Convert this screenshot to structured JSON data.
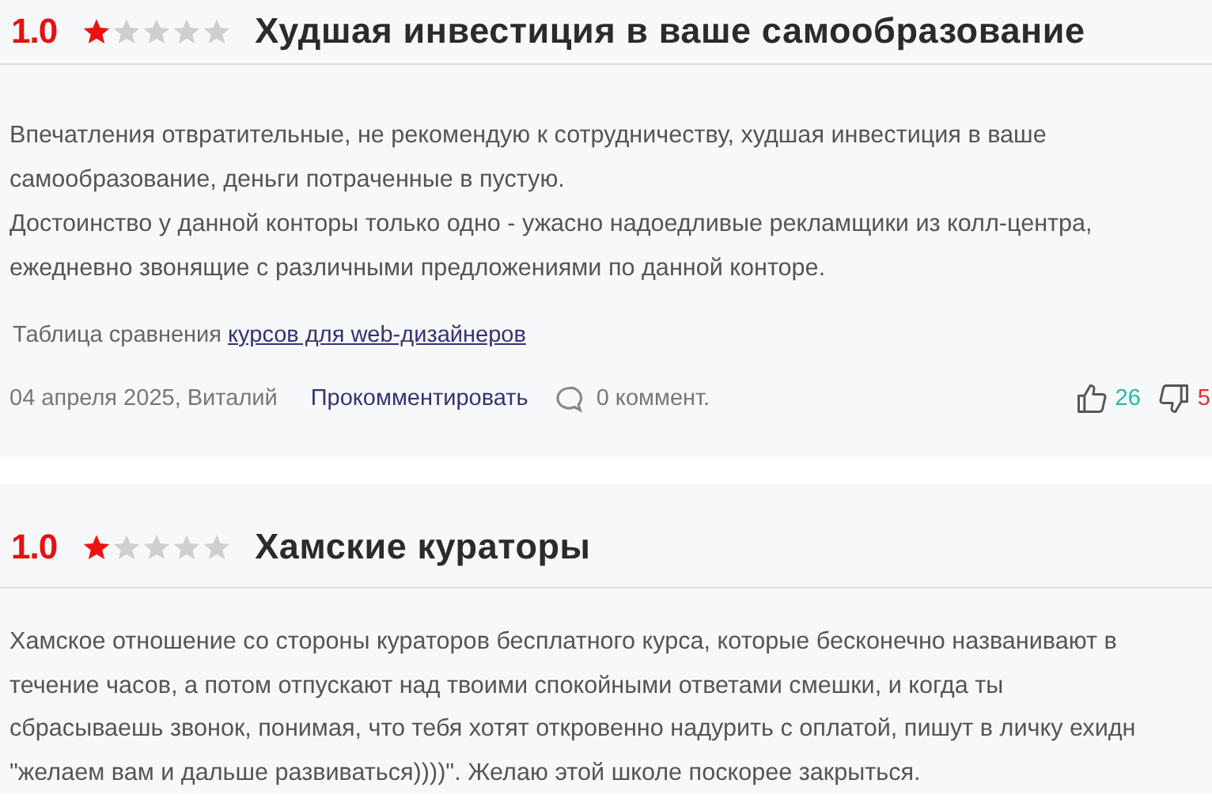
{
  "reviews": [
    {
      "rating": "1.0",
      "stars": 1,
      "title": "Худшая инвестиция в ваше самообразование",
      "text": "Впечатления отвратительные, не рекомендую к сотрудничеству, худшая инвестиция в ваше\nсамообразование, деньги потраченные в пустую.\nДостоинство у данной конторы только одно - ужасно надоедливые рекламщики из колл-центра,\nежедневно звонящие с различными предложениями по данной конторе.",
      "compare": {
        "text": "Таблица сравнения",
        "link": "курсов для web-дизайнеров"
      },
      "meta": "04 апреля 2025, Виталий",
      "comment_link": "Прокомментировать",
      "comments": "0 коммент.",
      "likes": "26",
      "dislikes": "5"
    },
    {
      "rating": "1.0",
      "stars": 1,
      "title": "Хамские кураторы",
      "text": "Хамское отношение со стороны кураторов бесплатного курса, которые бесконечно названивают в\nтечение часов, а потом отпускают над твоими спокойными ответами смешки, и когда ты\nсбрасываешь звонок, понимая, что тебя хотят откровенно надурить с оплатой, пишут в личку ехидн\n\"желаем вам и дальше развиваться))))\". Желаю этой школе поскорее закрыться."
    }
  ]
}
